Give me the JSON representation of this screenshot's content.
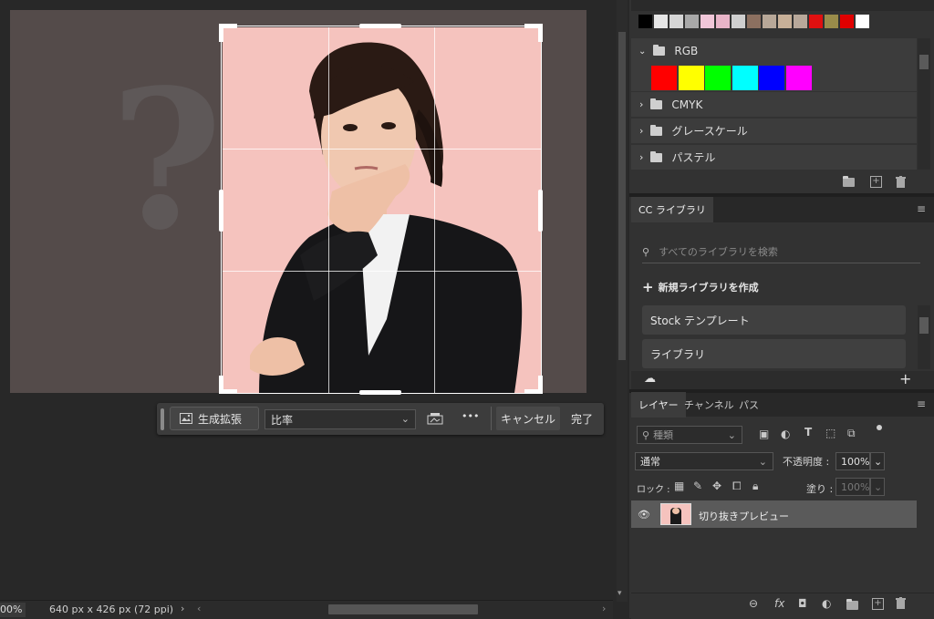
{
  "canvas": {
    "question_glyph": "?",
    "toolbar": {
      "generative_expand_label": "生成拡張",
      "ratio_value": "比率",
      "more_label": "•••",
      "cancel_label": "キャンセル",
      "done_label": "完了"
    }
  },
  "status": {
    "zoom": "00%",
    "doc_info": "640 px x 426 px (72 ppi)"
  },
  "swatches": {
    "colors": [
      "#000000",
      "#e6e6e6",
      "#d5d5d5",
      "#a8a8a8",
      "#f0c6d8",
      "#e8b4c8",
      "#cfcfcf",
      "#8c7060",
      "#b8a898",
      "#c8b098",
      "#b8a89a",
      "#e01010",
      "#9a8c4a",
      "#e00000",
      "#ffffff"
    ],
    "groups": [
      {
        "label": "RGB",
        "expanded": true,
        "colors": [
          "#ff0000",
          "#ffff00",
          "#00ff00",
          "#00ffff",
          "#0000ff",
          "#ff00ff"
        ]
      },
      {
        "label": "CMYK",
        "expanded": false
      },
      {
        "label": "グレースケール",
        "expanded": false
      },
      {
        "label": "パステル",
        "expanded": false
      }
    ]
  },
  "libraries": {
    "tab_label": "CC ライブラリ",
    "search_placeholder": "すべてのライブラリを検索",
    "create_label": "新規ライブラリを作成",
    "items": [
      "Stock テンプレート",
      "ライブラリ"
    ]
  },
  "layers": {
    "tabs": [
      "レイヤー",
      "チャンネル",
      "パス"
    ],
    "filter_placeholder": "種類",
    "blend_mode": "通常",
    "opacity_label": "不透明度 :",
    "opacity_value": "100%",
    "lock_label": "ロック :",
    "fill_label": "塗り :",
    "fill_value": "100%",
    "layer_name": "切り抜きプレビュー"
  }
}
